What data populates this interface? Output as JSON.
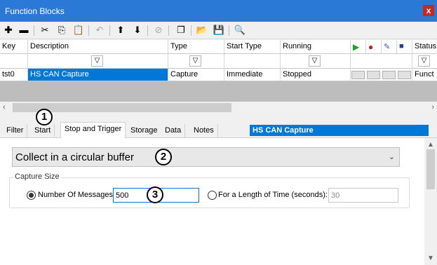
{
  "window": {
    "title": "Function Blocks",
    "close_glyph": "x"
  },
  "toolbar": {
    "icons": [
      "add-icon",
      "remove-icon",
      "cut-icon",
      "copy-icon",
      "paste-icon",
      "undo-icon",
      "move-up-icon",
      "move-down-icon",
      "disable-icon",
      "cascade-icon",
      "open-icon",
      "save-icon",
      "zoom-icon"
    ]
  },
  "grid": {
    "columns": [
      "Key",
      "Description",
      "Type",
      "Start Type",
      "Running",
      "Status"
    ],
    "row": {
      "key": "tst0",
      "description": "HS CAN Capture",
      "type": "Capture",
      "start_type": "Immediate",
      "running": "Stopped",
      "status": "Funct"
    },
    "action_icons": [
      "play-icon",
      "record-icon",
      "edit-icon",
      "save-icon"
    ]
  },
  "tabs": [
    "Filter",
    "Start",
    "Stop and Trigger",
    "Storage",
    "Data",
    "Notes"
  ],
  "active_tab": "Stop and Trigger",
  "function_block_title": "HS CAN Capture",
  "collect_mode": {
    "value": "Collect in a circular buffer"
  },
  "capture_size": {
    "group_label": "Capture Size",
    "messages_label": "Number Of Messages:",
    "messages_value": "500",
    "time_label": "For a Length of Time (seconds):",
    "time_value": "30",
    "selected": "messages"
  },
  "callouts": [
    "1",
    "2",
    "3"
  ],
  "colors": {
    "title_bar": "#2b79d6",
    "selection": "#0078d7",
    "close": "#c42b1c"
  }
}
